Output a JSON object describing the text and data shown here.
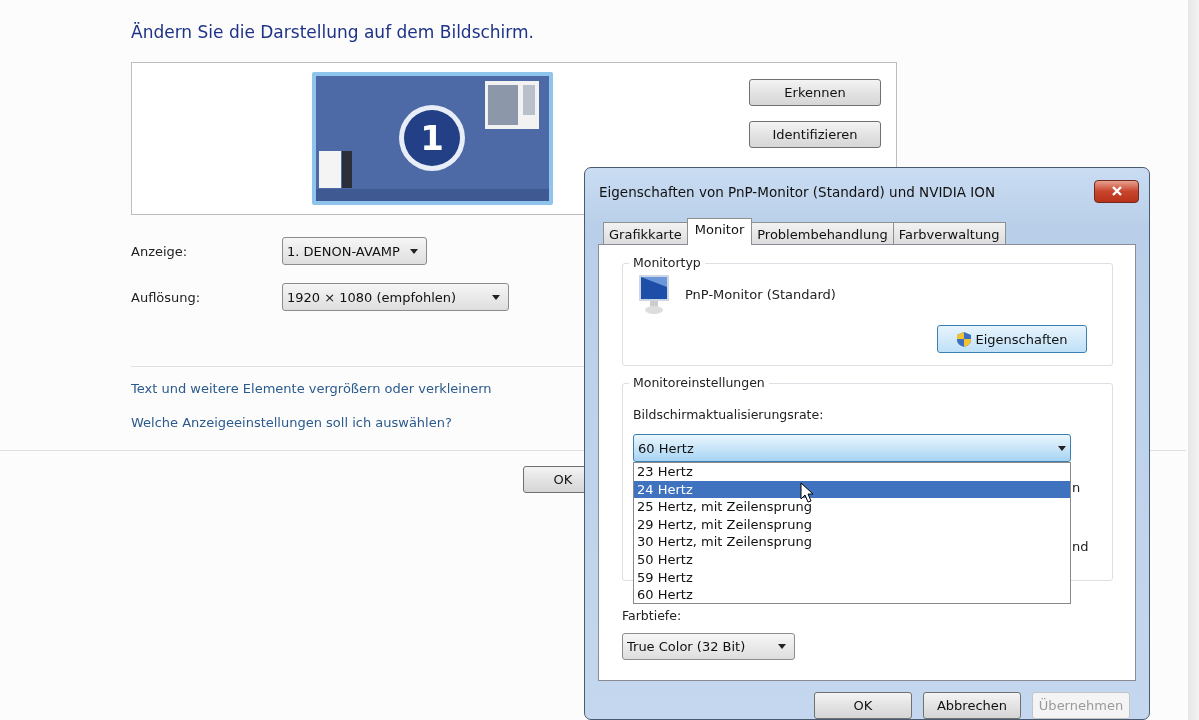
{
  "page": {
    "heading": "Ändern Sie die Darstellung auf dem Bildschirm.",
    "preview": {
      "display_number": "1"
    },
    "side_buttons": [
      "Erkennen",
      "Identifizieren"
    ],
    "fields": [
      {
        "label": "Anzeige:",
        "value": "1. DENON-AVAMP"
      },
      {
        "label": "Auflösung:",
        "value": "1920 × 1080 (empfohlen)"
      }
    ],
    "links": [
      "Text und weitere Elemente vergrößern oder verkleinern",
      "Welche Anzeigeeinstellungen soll ich auswählen?"
    ],
    "footer_buttons": [
      "OK"
    ]
  },
  "dialog": {
    "title": "Eigenschaften von PnP-Monitor (Standard) und NVIDIA ION",
    "tabs": [
      {
        "label": "Grafikkarte",
        "selected": false
      },
      {
        "label": "Monitor",
        "selected": true
      },
      {
        "label": "Problembehandlung",
        "selected": false
      },
      {
        "label": "Farbverwaltung",
        "selected": false
      }
    ],
    "monitor_type": {
      "group_title": "Monitortyp",
      "name": "PnP-Monitor (Standard)",
      "button": "Eigenschaften"
    },
    "monitor_settings": {
      "group_title": "Monitoreinstellungen",
      "refresh_label": "Bildschirmaktualisierungsrate:",
      "refresh_value": "60 Hertz",
      "refresh_options": [
        {
          "label": "23 Hertz",
          "selected": false
        },
        {
          "label": "24 Hertz",
          "selected": true
        },
        {
          "label": "25 Hertz, mit Zeilensprung",
          "selected": false
        },
        {
          "label": "29 Hertz, mit Zeilensprung",
          "selected": false
        },
        {
          "label": "30 Hertz, mit Zeilensprung",
          "selected": false
        },
        {
          "label": "50 Hertz",
          "selected": false
        },
        {
          "label": "59 Hertz",
          "selected": false
        },
        {
          "label": "60 Hertz",
          "selected": false
        }
      ],
      "covered_texts": [
        "n",
        "nd"
      ]
    },
    "color_depth": {
      "label": "Farbtiefe:",
      "value": "True Color (32 Bit)"
    },
    "buttons": [
      {
        "label": "OK",
        "disabled": false
      },
      {
        "label": "Abbrechen",
        "disabled": false
      },
      {
        "label": "Übernehmen",
        "disabled": true
      }
    ]
  }
}
